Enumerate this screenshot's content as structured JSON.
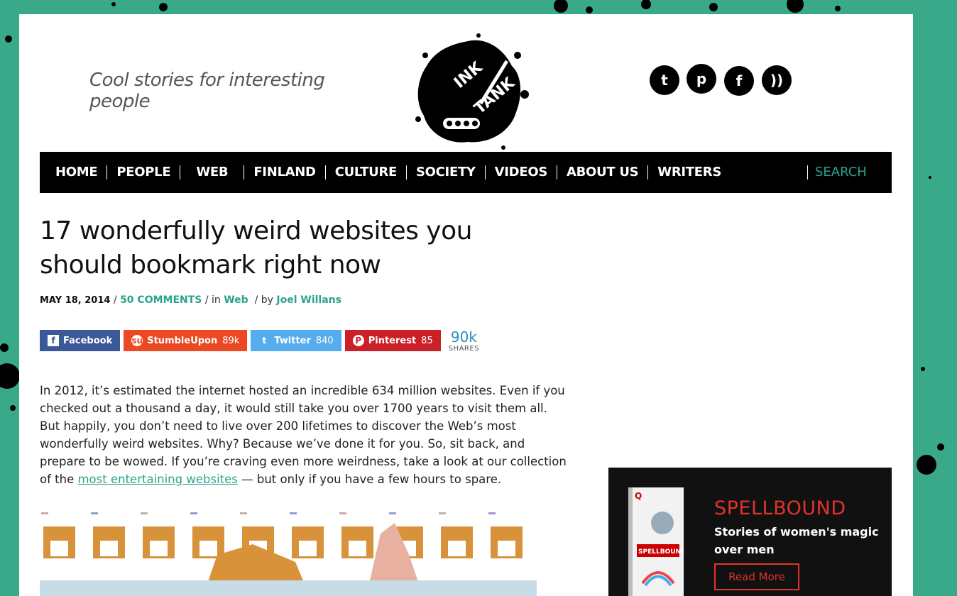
{
  "header": {
    "tagline": "Cool stories for interesting people",
    "logo_text_1": "INK",
    "logo_text_2": "TANK",
    "social": [
      {
        "icon": "twitter-icon",
        "glyph": "t"
      },
      {
        "icon": "pinterest-icon",
        "glyph": "p"
      },
      {
        "icon": "facebook-icon",
        "glyph": "f"
      },
      {
        "icon": "feed-icon",
        "glyph": "))"
      }
    ]
  },
  "nav": {
    "items": [
      "HOME",
      "PEOPLE",
      "WEB",
      "FINLAND",
      "CULTURE",
      "SOCIETY",
      "VIDEOS",
      "ABOUT US",
      "WRITERS"
    ],
    "search_label": "SEARCH"
  },
  "article": {
    "title": "17 wonderfully weird websites you should bookmark right now",
    "date": "MAY 18, 2014",
    "sep1": " / ",
    "comments": "50 COMMENTS",
    "in_label": " / in ",
    "category": "Web",
    "by_label": "  / by ",
    "author": "Joel Willans",
    "body_before_link": "In 2012, it’s estimated the internet hosted an incredible 634 million websites. Even if you checked out a thousand a day, it would still take you over 1700 years to visit them all. But happily, you don’t need to live over 200 lifetimes to discover the Web’s most wonderfully weird websites. Why? Because we’ve done it for you. So, sit back, and prepare to be wowed. If you’re craving even more weirdness, take a look at our collection of the ",
    "body_link": "most entertaining websites",
    "body_after_link": " — but only if you have a few hours to spare."
  },
  "share": {
    "facebook": {
      "label": "Facebook",
      "count": ""
    },
    "stumbleupon": {
      "label": "StumbleUpon",
      "count": "89k"
    },
    "twitter": {
      "label": "Twitter",
      "count": "840"
    },
    "pinterest": {
      "label": "Pinterest",
      "count": "85"
    },
    "total": "90k",
    "total_label": "SHARES"
  },
  "ad": {
    "headline": "SPELLBOUND",
    "subtitle": "Stories of women's magic over men",
    "button": "Read More",
    "book_title": "SPELLBOUND"
  },
  "colors": {
    "accent": "#2aa38c",
    "background": "#3aa98a",
    "ad_red": "#e0332b"
  }
}
